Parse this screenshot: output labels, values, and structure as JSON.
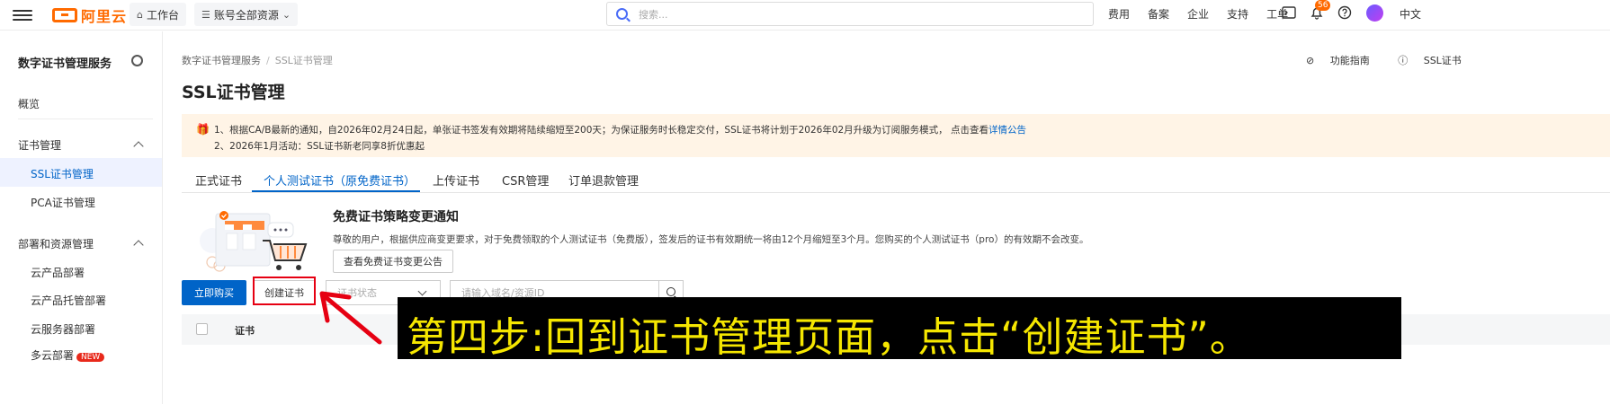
{
  "topbar": {
    "logo_text": "阿里云",
    "workbench": "工作台",
    "resources": "账号全部资源",
    "search_placeholder": "搜索...",
    "links": [
      "费用",
      "备案",
      "企业",
      "支持",
      "工单"
    ],
    "notification_count": "56",
    "lang": "中文"
  },
  "sidebar": {
    "title": "数字证书管理服务",
    "overview": "概览",
    "group_cert": "证书管理",
    "ssl": "SSL证书管理",
    "pca": "PCA证书管理",
    "group_deploy": "部署和资源管理",
    "cloud_deploy": "云产品部署",
    "cloud_hosted": "云产品托管部署",
    "server_deploy": "云服务器部署",
    "more": "多云部署",
    "new_badge": "NEW"
  },
  "breadcrumb": {
    "root": "数字证书管理服务",
    "current": "SSL证书管理"
  },
  "page_title": "SSL证书管理",
  "help": {
    "guide": "功能指南",
    "ssl": "SSL证书"
  },
  "notice": {
    "line1": "1、根据CA/B最新的通知，自2026年02月24日起，单张证书签发有效期将陆续缩短至200天；为保证服务时长稳定交付，SSL证书将计划于2026年02月升级为订阅服务模式， 点击查看",
    "line1_link": "详情公告",
    "line2": "2、2026年1月活动：SSL证书新老同享8折优惠起"
  },
  "tabs": [
    "正式证书",
    "个人测试证书（原免费证书）",
    "上传证书",
    "CSR管理",
    "订单退款管理"
  ],
  "promo": {
    "title": "免费证书策略变更通知",
    "desc": "尊敬的用户，根据供应商变更要求，对于免费领取的个人测试证书（免费版），签发后的证书有效期统一将由12个月缩短至3个月。您购买的个人测试证书（pro）的有效期不会改变。",
    "button": "查看免费证书变更公告"
  },
  "actions": {
    "buy": "立即购买",
    "create": "创建证书",
    "status_placeholder": "证书状态",
    "domain_placeholder": "请输入域名/资源ID"
  },
  "table": {
    "col_cert": "证书"
  },
  "caption": "第四步:回到证书管理页面，点击“创建证书”。",
  "colors": {
    "accent": "#0064c8",
    "brand": "#ff6a00",
    "highlight": "#e60012",
    "caption_text": "#f5e600"
  }
}
